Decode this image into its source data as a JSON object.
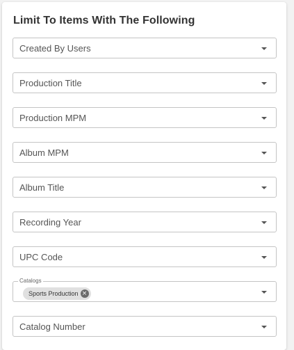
{
  "panel": {
    "title": "Limit To Items With The Following"
  },
  "fields": [
    {
      "label": "Created By Users"
    },
    {
      "label": "Production Title"
    },
    {
      "label": "Production MPM"
    },
    {
      "label": "Album MPM"
    },
    {
      "label": "Album Title"
    },
    {
      "label": "Recording Year"
    },
    {
      "label": "UPC Code"
    },
    {
      "label": "Catalogs",
      "chips": [
        "Sports Production"
      ]
    },
    {
      "label": "Catalog Number"
    }
  ],
  "icons": {
    "dropdown": "caret-down-icon",
    "chip_remove": "close-circle-icon"
  },
  "colors": {
    "border": "#c4c4c4",
    "chip_bg": "#e0e0e0",
    "text": "#555555"
  }
}
